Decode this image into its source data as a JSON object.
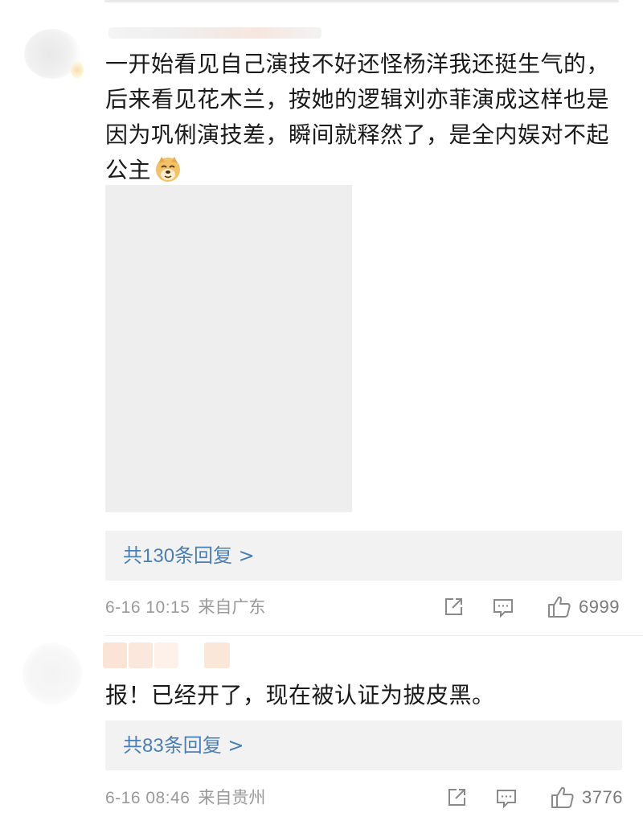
{
  "comments": [
    {
      "text": "一开始看见自己演技不好还怪杨洋我还挺生气的，后来看见花木兰，按她的逻辑刘亦菲演成这样也是因为巩俐演技差，瞬间就释然了，是全内娱对不起公主",
      "emoji": "doge-emoji",
      "replies_prefix": "共",
      "replies_count": "130",
      "replies_suffix": "条回复 >",
      "date": "6-16 10:15",
      "location": "来自广东",
      "likes": "6999"
    },
    {
      "text": "报！已经开了，现在被认证为披皮黑。",
      "replies_prefix": "共",
      "replies_count": "83",
      "replies_suffix": "条回复 >",
      "date": "6-16 08:46",
      "location": "来自贵州",
      "likes": "3776"
    }
  ],
  "icons": {
    "share": "share-icon",
    "comment": "comment-icon",
    "like": "thumbs-up-icon"
  },
  "colors": {
    "link_blue": "#4a7fb5",
    "meta_gray": "#9a9a9a",
    "reply_bg": "#f2f2f2",
    "image_placeholder": "#eeeeee"
  }
}
